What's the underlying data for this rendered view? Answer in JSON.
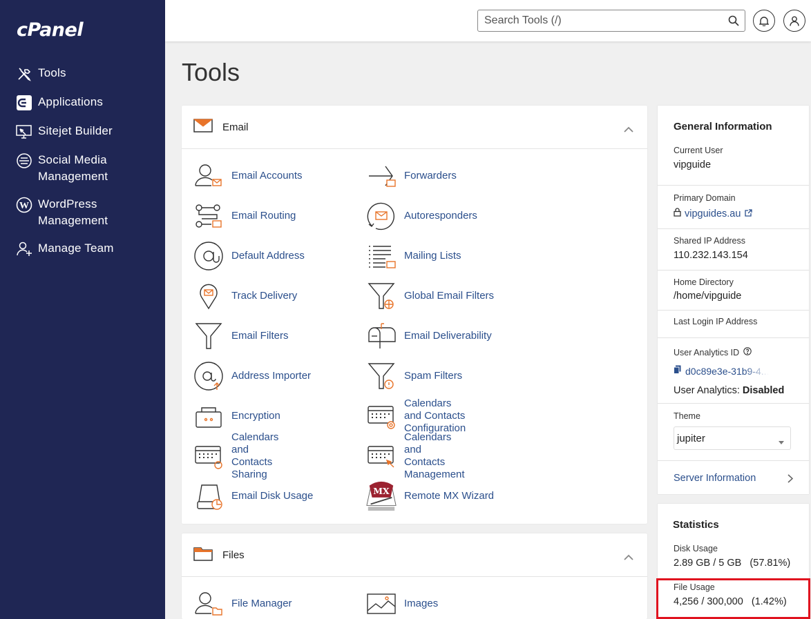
{
  "sidebar": {
    "logo": "cPanel",
    "items": [
      {
        "label": "Tools",
        "icon": "tools-icon"
      },
      {
        "label": "Applications",
        "icon": "applications-icon"
      },
      {
        "label": "Sitejet Builder",
        "icon": "sitejet-icon"
      },
      {
        "label": "Social Media\nManagement",
        "icon": "social-media-icon"
      },
      {
        "label": "WordPress\nManagement",
        "icon": "wordpress-icon"
      },
      {
        "label": "Manage Team",
        "icon": "manage-team-icon"
      }
    ]
  },
  "header": {
    "search_placeholder": "Search Tools (/)"
  },
  "page": {
    "title": "Tools"
  },
  "email_section": {
    "title": "Email",
    "tools": [
      {
        "label": "Email Accounts",
        "icon": "email-accounts-icon"
      },
      {
        "label": "Forwarders",
        "icon": "forwarders-icon"
      },
      {
        "label": "Email Routing",
        "icon": "email-routing-icon"
      },
      {
        "label": "Autoresponders",
        "icon": "autoresponders-icon"
      },
      {
        "label": "Default Address",
        "icon": "default-address-icon"
      },
      {
        "label": "Mailing Lists",
        "icon": "mailing-lists-icon"
      },
      {
        "label": "Track Delivery",
        "icon": "track-delivery-icon"
      },
      {
        "label": "Global Email Filters",
        "icon": "global-email-filters-icon"
      },
      {
        "label": "Email Filters",
        "icon": "email-filters-icon"
      },
      {
        "label": "Email Deliverability",
        "icon": "email-deliverability-icon"
      },
      {
        "label": "Address Importer",
        "icon": "address-importer-icon"
      },
      {
        "label": "Spam Filters",
        "icon": "spam-filters-icon"
      },
      {
        "label": "Encryption",
        "icon": "encryption-icon"
      },
      {
        "label": "Calendars and Contacts\nConfiguration",
        "icon": "calendars-config-icon"
      },
      {
        "label": "Calendars and Contacts\nSharing",
        "icon": "calendars-sharing-icon"
      },
      {
        "label": "Calendars and Contacts\nManagement",
        "icon": "calendars-management-icon"
      },
      {
        "label": "Email Disk Usage",
        "icon": "email-disk-usage-icon"
      },
      {
        "label": "Remote MX Wizard",
        "icon": "remote-mx-wizard-icon"
      }
    ]
  },
  "files_section": {
    "title": "Files",
    "tools": [
      {
        "label": "File Manager",
        "icon": "file-manager-icon"
      },
      {
        "label": "Images",
        "icon": "images-icon"
      }
    ]
  },
  "general_info": {
    "title": "General Information",
    "current_user_label": "Current User",
    "current_user": "vipguide",
    "primary_domain_label": "Primary Domain",
    "primary_domain": "vipguides.au",
    "shared_ip_label": "Shared IP Address",
    "shared_ip": "110.232.143.154",
    "home_dir_label": "Home Directory",
    "home_dir": "/home/vipguide",
    "last_login_label": "Last Login IP Address",
    "analytics_id_label": "User Analytics ID",
    "analytics_id": "d0c89e3e-31b9-4...",
    "analytics_status_label": "User Analytics: ",
    "analytics_status": "Disabled",
    "theme_label": "Theme",
    "theme_value": "jupiter",
    "server_info": "Server Information"
  },
  "statistics": {
    "title": "Statistics",
    "disk_usage_label": "Disk Usage",
    "disk_usage_value": "2.89 GB / 5 GB",
    "disk_usage_pct": "(57.81%)",
    "file_usage_label": "File Usage",
    "file_usage_value": "4,256 / 300,000",
    "file_usage_pct": "(1.42%)"
  },
  "colors": {
    "sidebar_bg": "#1f2654",
    "link": "#2b4f8c",
    "accent_orange": "#e8742a",
    "highlight_red": "#e0131f"
  }
}
